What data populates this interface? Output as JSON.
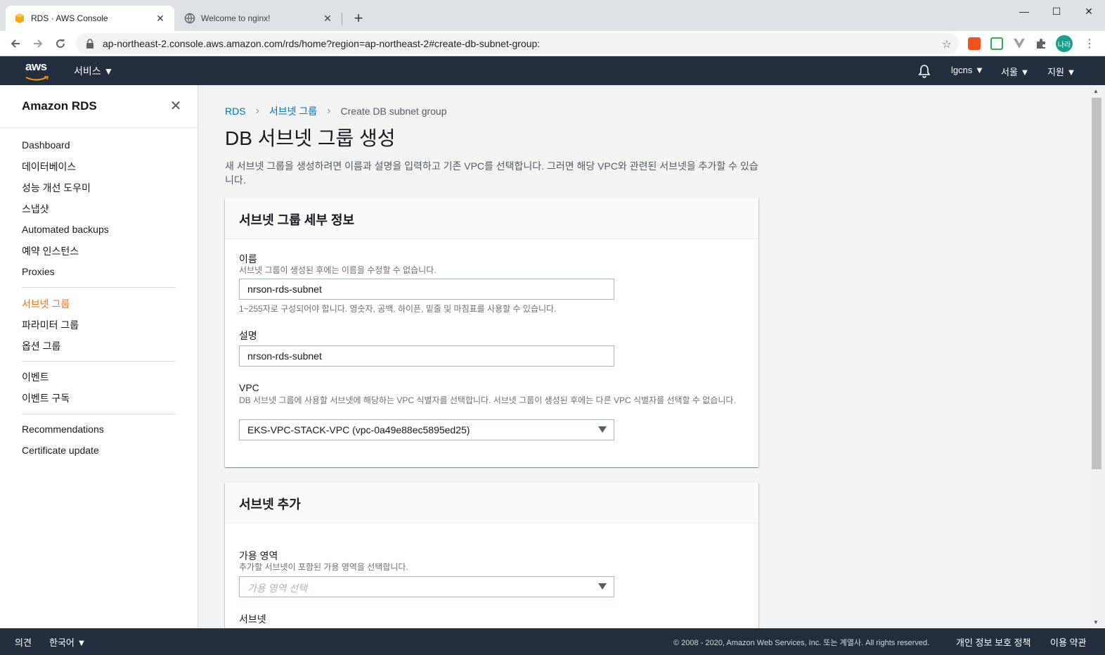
{
  "browser": {
    "tabs": [
      {
        "title": "RDS · AWS Console"
      },
      {
        "title": "Welcome to nginx!"
      }
    ],
    "url": "ap-northeast-2.console.aws.amazon.com/rds/home?region=ap-northeast-2#create-db-subnet-group:",
    "profile_badge": "나라",
    "window_controls": {
      "minimize": "—",
      "maximize": "☐",
      "close": "✕"
    }
  },
  "aws_nav": {
    "logo_text": "aws",
    "services_label": "서비스",
    "account": "lgcns",
    "region": "서울",
    "support": "지원"
  },
  "sidebar": {
    "title": "Amazon RDS",
    "items": [
      {
        "label": "Dashboard"
      },
      {
        "label": "데이터베이스"
      },
      {
        "label": "성능 개선 도우미"
      },
      {
        "label": "스냅샷"
      },
      {
        "label": "Automated backups"
      },
      {
        "label": "예약 인스턴스"
      },
      {
        "label": "Proxies"
      },
      {
        "label": "서브넷 그룹"
      },
      {
        "label": "파라미터 그룹"
      },
      {
        "label": "옵션 그룹"
      },
      {
        "label": "이벤트"
      },
      {
        "label": "이벤트 구독"
      },
      {
        "label": "Recommendations"
      },
      {
        "label": "Certificate update"
      }
    ]
  },
  "breadcrumb": {
    "items": [
      "RDS",
      "서브넷 그룹",
      "Create DB subnet group"
    ]
  },
  "page": {
    "title": "DB 서브넷 그룹 생성",
    "description": "새 서브넷 그룹을 생성하려면 이름과 설명을 입력하고 기존 VPC를 선택합니다. 그러면 해당 VPC와 관련된 서브넷을 추가할 수 있습니다."
  },
  "details_panel": {
    "heading": "서브넷 그룹 세부 정보",
    "name_label": "이름",
    "name_desc": "서브넷 그룹이 생성된 후에는 이름을 수정할 수 없습니다.",
    "name_value": "nrson-rds-subnet",
    "name_hint": "1~255자로 구성되어야 합니다. 영숫자, 공백, 하이픈, 밑줄 및 마침표를 사용할 수 있습니다.",
    "desc_label": "설명",
    "desc_value": "nrson-rds-subnet",
    "vpc_label": "VPC",
    "vpc_desc": "DB 서브넷 그룹에 사용할 서브넷에 해당하는 VPC 식별자를 선택합니다. 서브넷 그룹이 생성된 후에는 다른 VPC 식별자를 선택할 수 없습니다.",
    "vpc_value": "EKS-VPC-STACK-VPC (vpc-0a49e88ec5895ed25)"
  },
  "subnets_panel": {
    "heading": "서브넷 추가",
    "az_label": "가용 영역",
    "az_desc": "추가할 서브넷이 포함된 가용 영역을 선택합니다.",
    "az_placeholder": "가용 영역 선택",
    "subnet_label": "서브넷"
  },
  "footer": {
    "feedback": "의견",
    "language": "한국어",
    "copyright": "© 2008 - 2020, Amazon Web Services, Inc. 또는 계열사. All rights reserved.",
    "privacy": "개인 정보 보호 정책",
    "terms": "이용 약관"
  },
  "colors": {
    "aws_nav": "#232f3e",
    "link": "#0073bb",
    "active_nav": "#ec7211",
    "main_bg": "#f2f3f3"
  }
}
